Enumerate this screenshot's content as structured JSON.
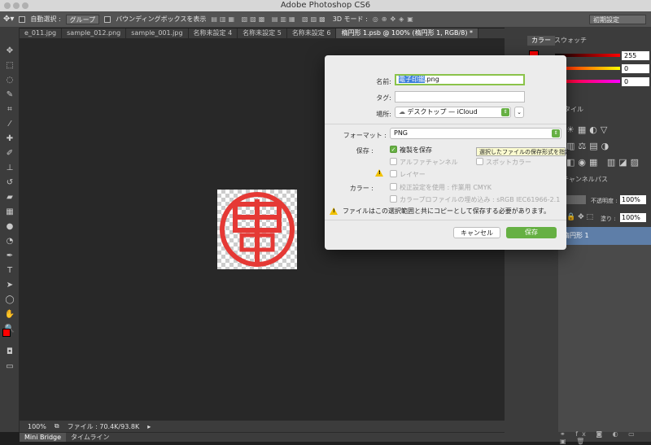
{
  "window": {
    "title": "Adobe Photoshop CS6"
  },
  "options_bar": {
    "auto_select_label": "自動選択 :",
    "auto_select_value": "グループ",
    "show_bounding_label": "バウンディングボックスを表示",
    "mode_3d_label": "3D モード :",
    "workspace": "初期設定"
  },
  "doc_tabs": [
    "e_011.jpg",
    "sample_012.png",
    "sample_001.jpg",
    "名称未設定 4",
    "名称未設定 5",
    "名称未設定 6",
    "楕円形 1.psb @ 100% (楕円形 1, RGB/8) *"
  ],
  "status": {
    "zoom": "100%",
    "file_info": "ファイル : 70.4K/93.8K"
  },
  "bottom_tabs": [
    "Mini Bridge",
    "タイムライン"
  ],
  "panels": {
    "color_tabs": [
      "カラー",
      "スウォッチ"
    ],
    "color_values": [
      "255",
      "0",
      "0"
    ],
    "style_tab": "スタイル",
    "layers_tabs": [
      "チャンネル",
      "パス"
    ],
    "opacity_label": "不透明度 :",
    "opacity_value": "100%",
    "fill_label": "塗り :",
    "fill_value": "100%",
    "layer_name": "楕円形 1"
  },
  "dialog": {
    "name_label": "名前:",
    "name_selected": "電子印鑑",
    "name_rest": ".png",
    "tag_label": "タグ:",
    "where_label": "場所:",
    "where_value": "デスクトップ — iCloud",
    "format_label": "フォーマット :",
    "format_value": "PNG",
    "save_label": "保存 :",
    "save_options": [
      {
        "label": "複製を保存",
        "checked": true,
        "enabled": true
      },
      {
        "label": "アルファチャンネル",
        "checked": false,
        "enabled": false
      },
      {
        "label": "スポットカラー",
        "checked": false,
        "enabled": false
      },
      {
        "label": "レイヤー",
        "checked": false,
        "enabled": false
      }
    ],
    "color_label": "カラー :",
    "color_options": [
      {
        "label": "校正設定を使用 : 作業用 CMYK",
        "enabled": false
      },
      {
        "label": "カラープロファイルの埋め込み : sRGB IEC61966-2.1",
        "enabled": false
      }
    ],
    "warning": "ファイルはこの選択範囲と共にコピーとして保存する必要があります。",
    "cancel_label": "キャンセル",
    "save_button_label": "保存",
    "tooltip": "選択したファイルの保存形式を指定"
  },
  "colors": {
    "accent_green": "#66b043",
    "foreground": "#ff0000",
    "stamp_red": "#e53935"
  }
}
